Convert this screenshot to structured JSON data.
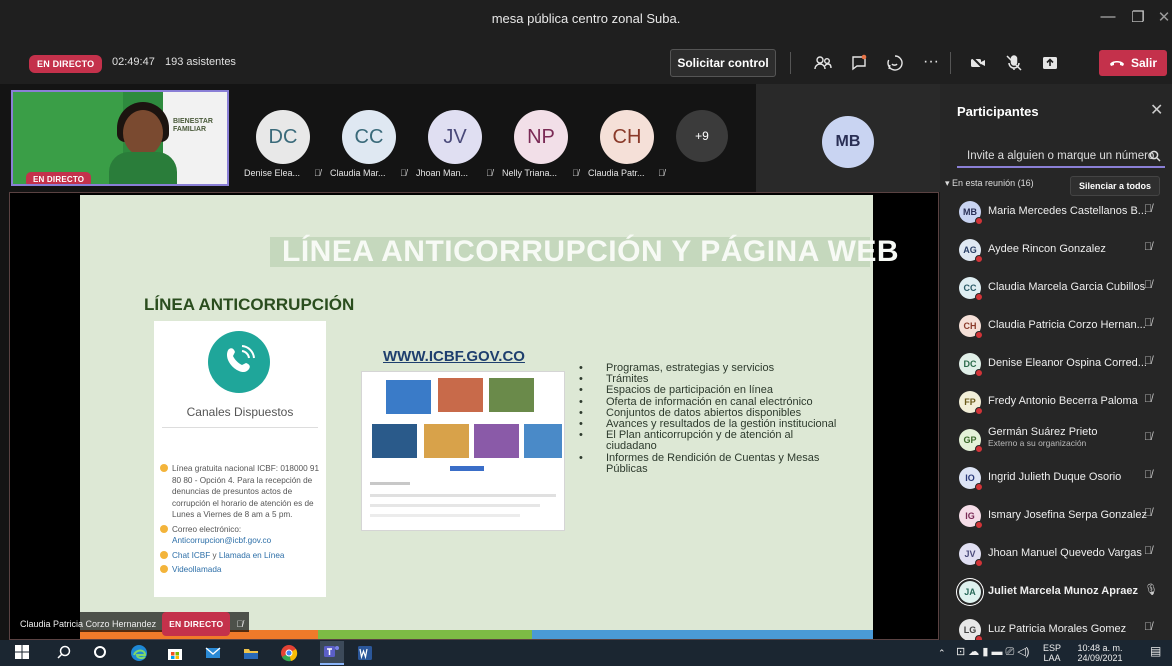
{
  "window": {
    "title": "mesa pública centro zonal Suba."
  },
  "toolbar": {
    "live_label": "EN DIRECTO",
    "elapsed": "02:49:47",
    "attendees": "193 asistentes",
    "request_control": "Solicitar control",
    "leave": "Salir"
  },
  "speaker": {
    "live_label": "EN DIRECTO",
    "sign_text": "BIENESTAR FAMILIAR"
  },
  "tiles": [
    {
      "initials": "DC",
      "name": "Denise Elea...",
      "bg": "#e8e8e8",
      "fg": "#3a6a7a"
    },
    {
      "initials": "CC",
      "name": "Claudia Mar...",
      "bg": "#dfe8f2",
      "fg": "#3a6a7a"
    },
    {
      "initials": "JV",
      "name": "Jhoan Man...",
      "bg": "#e0dff2",
      "fg": "#4a4a7a"
    },
    {
      "initials": "NP",
      "name": "Nelly Triana...",
      "bg": "#f2dfe8",
      "fg": "#7a2a55"
    },
    {
      "initials": "CH",
      "name": "Claudia Patr...",
      "bg": "#f5e0d8",
      "fg": "#8a3a2a"
    }
  ],
  "more_count": "+9",
  "spotlight_initials": "MB",
  "slide": {
    "title": "LÍNEA ANTICORRUPCIÓN Y PÁGINA WEB",
    "subtitle": "LÍNEA ANTICORRUPCIÓN",
    "card_title": "Canales Dispuestos",
    "line_text": "Línea gratuita nacional ICBF: 018000 91 80 80 - Opción 4. Para la recepción de denuncias de presuntos actos de corrupción el horario de atención es de Lunes a Viernes de 8 am a 5 pm.",
    "email_label": "Correo electrónico:",
    "email": "Anticorrupcion@icbf.gov.co",
    "chat_a": "Chat ICBF",
    "chat_mid": " y ",
    "chat_b": "Llamada en Línea",
    "video": "Videollamada",
    "web_title": "WWW.ICBF.GOV.CO",
    "bullets": [
      "Programas, estrategias y servicios",
      "Trámites",
      "Espacios de participación en línea",
      "Oferta de información en canal electrónico",
      "Conjuntos de datos abiertos disponibles",
      "Avances y resultados de la gestión institucional",
      "El Plan anticorrupción y de atención al ciudadano",
      "Informes de Rendición de Cuentas y Mesas Públicas"
    ]
  },
  "caption": {
    "name": "Claudia Patricia Corzo Hernandez",
    "live_label": "EN DIRECTO"
  },
  "panel": {
    "title": "Participantes",
    "invite_placeholder": "Invite a alguien o marque un número",
    "section": "En esta reunión (16)",
    "mute_all": "Silenciar a todos",
    "people": [
      {
        "initials": "MB",
        "name": "Maria Mercedes Castellanos B...",
        "bg": "#c9d4f2",
        "fg": "#2a2f55",
        "sub": ""
      },
      {
        "initials": "AG",
        "name": "Aydee Rincon Gonzalez",
        "bg": "#dfe8f2",
        "fg": "#2a3f66",
        "sub": ""
      },
      {
        "initials": "CC",
        "name": "Claudia Marcela Garcia Cubillos",
        "bg": "#dfeef2",
        "fg": "#2a5a66",
        "sub": ""
      },
      {
        "initials": "CH",
        "name": "Claudia Patricia Corzo Hernan...",
        "bg": "#f5e0d8",
        "fg": "#8a3a2a",
        "sub": ""
      },
      {
        "initials": "DC",
        "name": "Denise Eleanor Ospina Corred...",
        "bg": "#e0efe8",
        "fg": "#2a6a4a",
        "sub": ""
      },
      {
        "initials": "FP",
        "name": "Fredy Antonio Becerra Paloma",
        "bg": "#f2efd8",
        "fg": "#6a5a1a",
        "sub": ""
      },
      {
        "initials": "GP",
        "name": "Germán Suárez Prieto",
        "bg": "#e4f2d8",
        "fg": "#3a6a2a",
        "sub": "Externo a su organización"
      },
      {
        "initials": "IO",
        "name": "Ingrid Julieth Duque Osorio",
        "bg": "#dde4f5",
        "fg": "#2a3a7a",
        "sub": ""
      },
      {
        "initials": "IG",
        "name": "Ismary Josefina Serpa Gonzalez",
        "bg": "#f5dde8",
        "fg": "#7a2a55",
        "sub": ""
      },
      {
        "initials": "JV",
        "name": "Jhoan Manuel Quevedo Vargas",
        "bg": "#e0dff2",
        "fg": "#4a4a7a",
        "sub": ""
      },
      {
        "initials": "JA",
        "name": "Juliet Marcela Munoz Apraez",
        "bg": "#dff2ef",
        "fg": "#2a6a5a",
        "sub": ""
      },
      {
        "initials": "LG",
        "name": "Luz Patricia Morales Gomez",
        "bg": "#e8e8e8",
        "fg": "#444",
        "sub": ""
      }
    ]
  },
  "taskbar": {
    "lang": "ESP",
    "lang2": "LAA",
    "time": "10:48 a. m.",
    "date": "24/09/2021"
  }
}
